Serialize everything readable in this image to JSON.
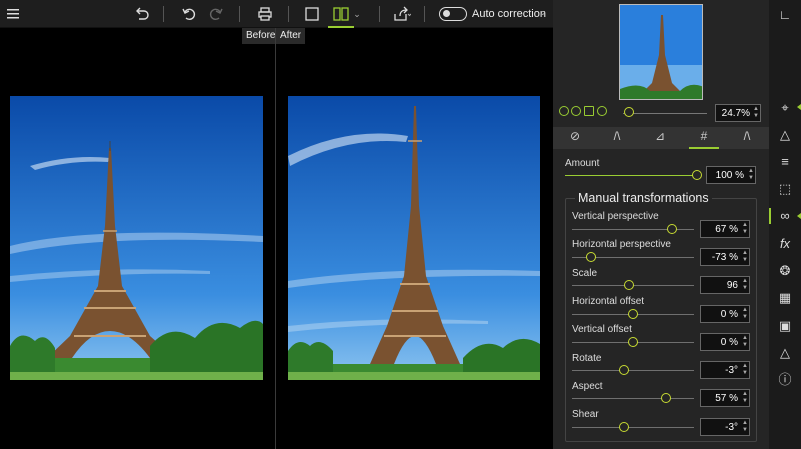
{
  "toolbar": {
    "menu_icon": "hamburger-icon",
    "auto_correction_label": "Auto correction"
  },
  "compare": {
    "before_label": "Before",
    "after_label": "After"
  },
  "navigator": {
    "zoom_value": "24.7%",
    "zoom_level": 0.05
  },
  "adjustments": {
    "amount_label": "Amount",
    "amount_value": "100 %",
    "group_title": "Manual transformations",
    "params": [
      {
        "label": "Vertical perspective",
        "value": "67 %"
      },
      {
        "label": "Horizontal perspective",
        "value": "-73 %"
      },
      {
        "label": "Scale",
        "value": "96"
      },
      {
        "label": "Horizontal offset",
        "value": "0 %"
      },
      {
        "label": "Vertical offset",
        "value": "0 %"
      },
      {
        "label": "Rotate",
        "value": "-3°"
      },
      {
        "label": "Aspect",
        "value": "57 %"
      },
      {
        "label": "Shear",
        "value": "-3°"
      }
    ]
  },
  "colors": {
    "accent": "#9acd32",
    "sky_top": "#0b4fb0",
    "sky_bottom": "#6fb0ea",
    "tower": "#7a5a3a"
  }
}
